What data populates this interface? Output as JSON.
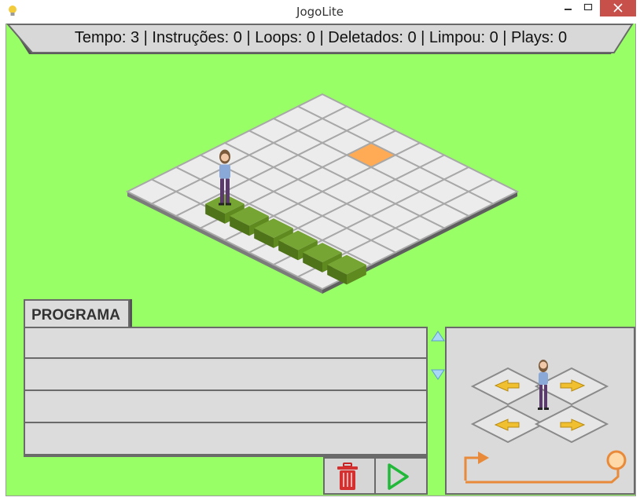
{
  "window": {
    "title": "JogoLite",
    "app_icon": "lightbulb-icon"
  },
  "status": {
    "text": "Tempo: 3 | Instruções: 0 | Loops: 0 | Deletados: 0 | Limpou: 0 | Plays: 0"
  },
  "program": {
    "tab_label": "PROGRAMA",
    "slots": 4
  },
  "colors": {
    "background": "#99ff66",
    "tile": "#ececec",
    "target": "#ffaa55",
    "block": "#6f9a2a",
    "delete": "#d43030",
    "play": "#22b83a",
    "loop": "#e88a3a"
  },
  "icons": [
    "scroll-up-icon",
    "scroll-down-icon",
    "trash-icon",
    "play-icon",
    "loop-icon",
    "arrow-left-icon",
    "arrow-right-icon",
    "character-icon"
  ]
}
